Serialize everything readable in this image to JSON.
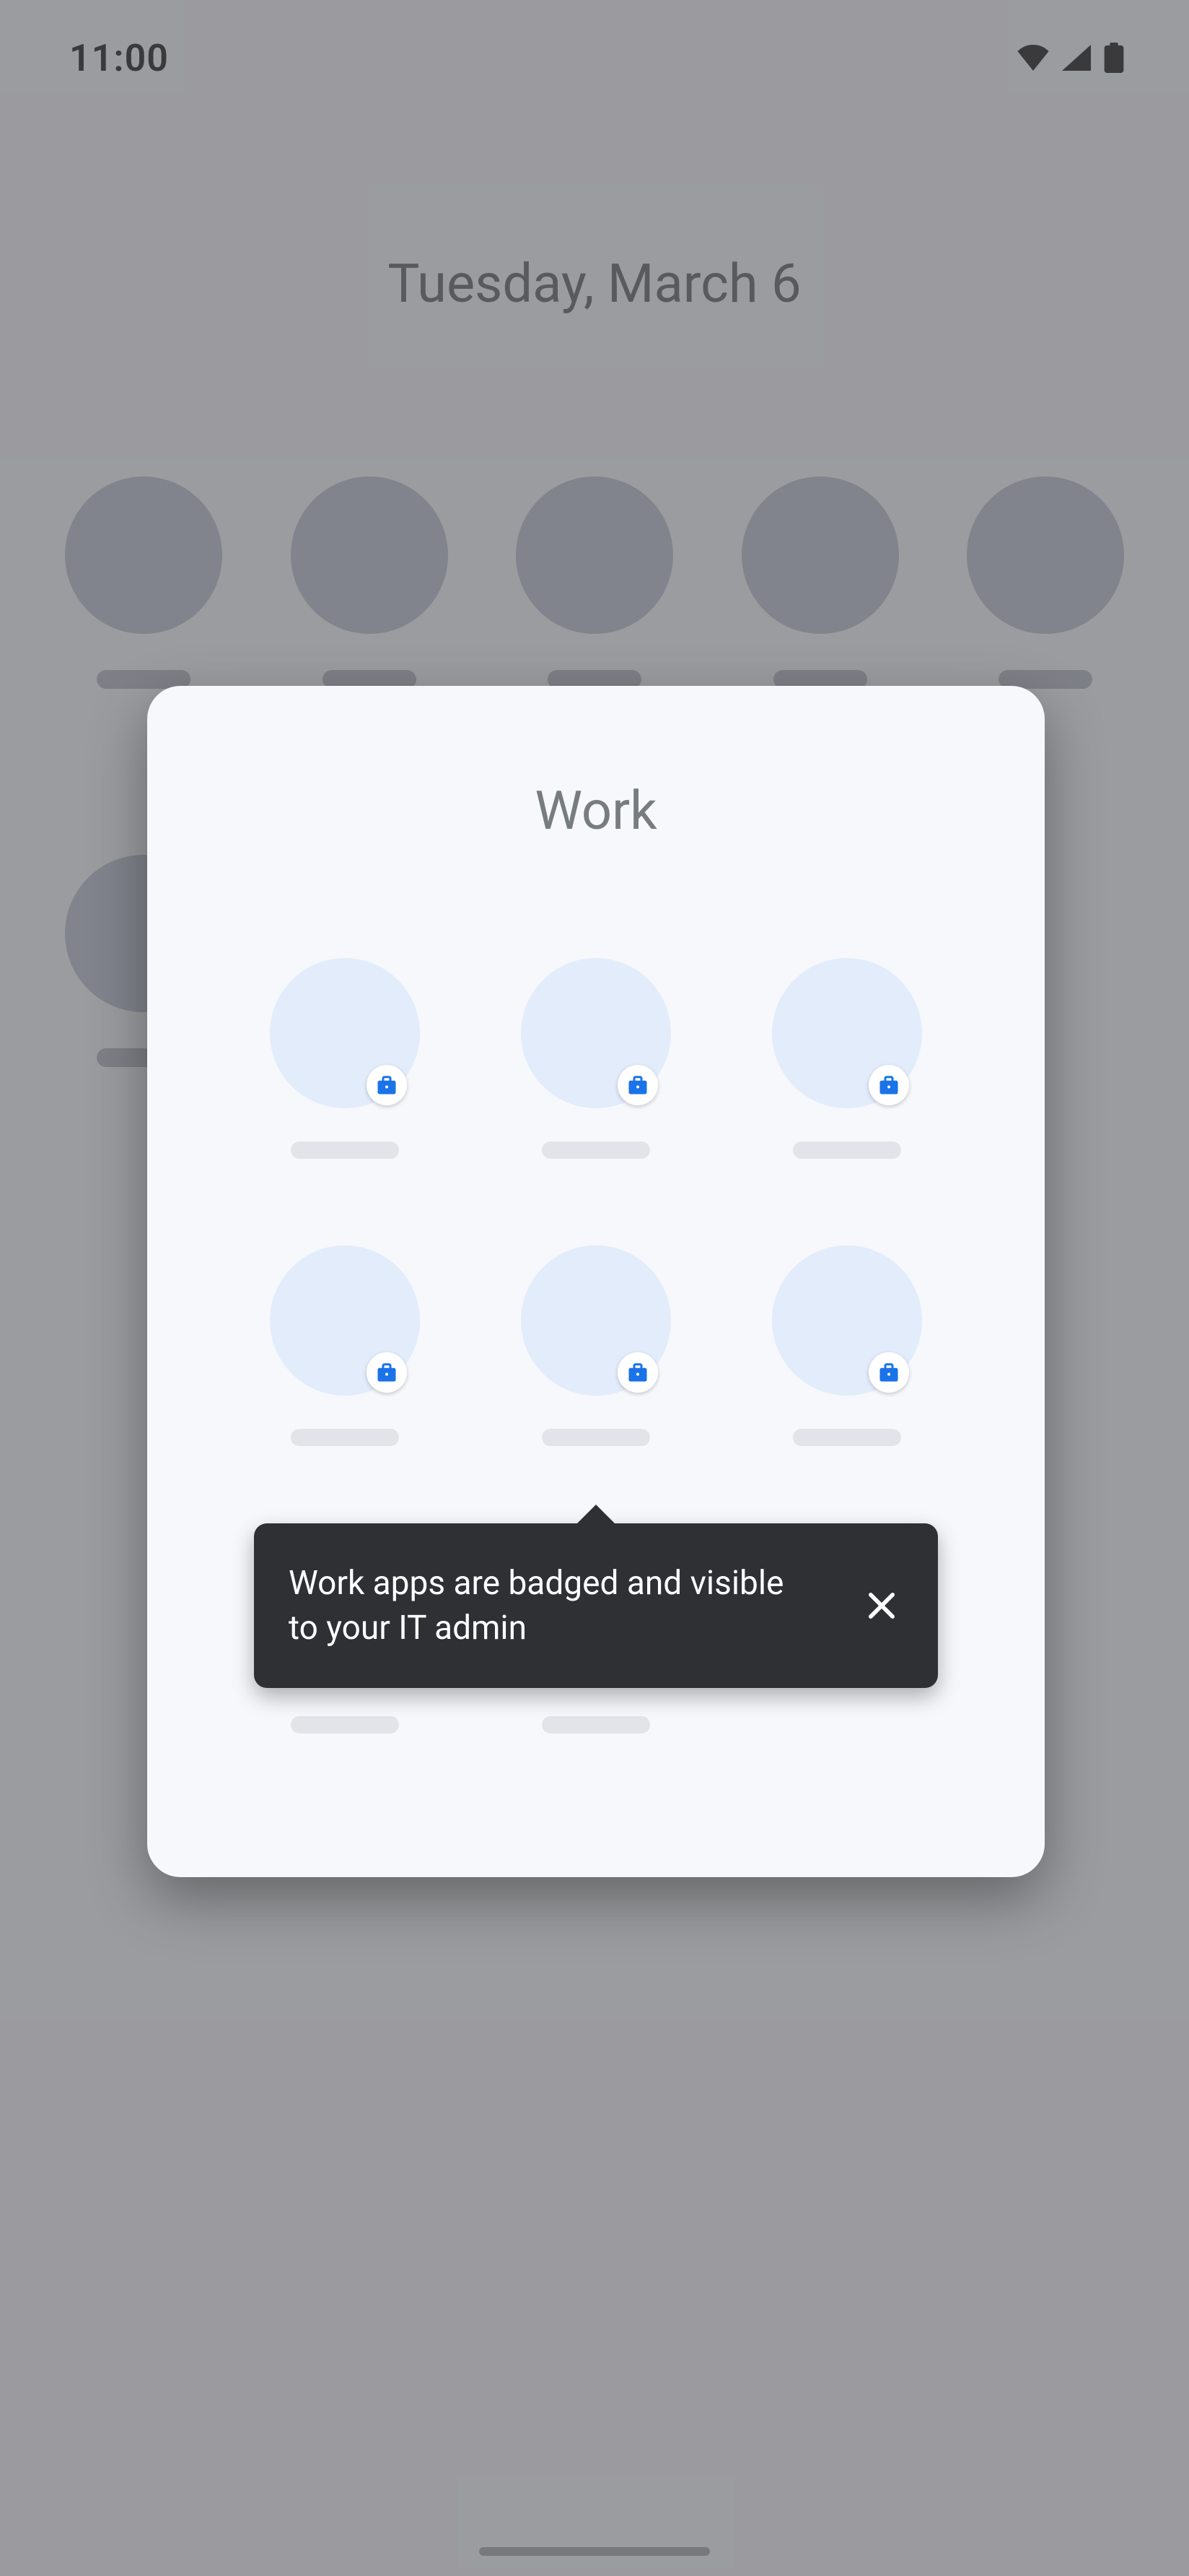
{
  "status": {
    "time": "11:00"
  },
  "home": {
    "date": "Tuesday, March 6"
  },
  "folder": {
    "title": "Work",
    "tooltip": "Work apps are badged and visible to your IT admin"
  },
  "icons": {
    "briefcase": "briefcase-icon",
    "close": "close-icon",
    "wifi": "wifi-icon",
    "signal": "cellular-signal-icon",
    "battery": "battery-icon"
  }
}
